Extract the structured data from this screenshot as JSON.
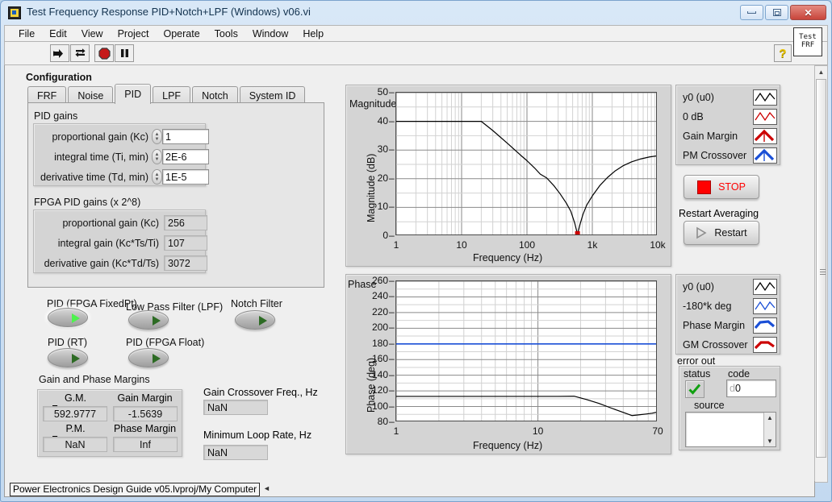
{
  "window": {
    "title": "Test Frequency Response PID+Notch+LPF (Windows) v06.vi",
    "minimize_label": "Minimize",
    "restore_label": "Restore",
    "close_label": "Close"
  },
  "menu": {
    "items": [
      "File",
      "Edit",
      "View",
      "Project",
      "Operate",
      "Tools",
      "Window",
      "Help"
    ]
  },
  "toolbar": {
    "run_label": "Run",
    "run_continuous_label": "Run Continuously",
    "abort_label": "Abort Execution",
    "pause_label": "Pause",
    "help_label": "?",
    "vi_icon_line1": "Test",
    "vi_icon_line2": "FRF"
  },
  "configuration": {
    "label": "Configuration",
    "tabs": [
      {
        "label": "FRF",
        "active": false
      },
      {
        "label": "Noise",
        "active": false
      },
      {
        "label": "PID",
        "active": true
      },
      {
        "label": "LPF",
        "active": false
      },
      {
        "label": "Notch",
        "active": false
      },
      {
        "label": "System ID",
        "active": false
      }
    ]
  },
  "pid_gains": {
    "title": "PID gains",
    "rows": [
      {
        "label": "proportional gain (Kc)",
        "value": "1"
      },
      {
        "label": "integral time (Ti, min)",
        "value": "2E-6"
      },
      {
        "label": "derivative time (Td, min)",
        "value": "1E-5"
      }
    ]
  },
  "fpga_pid_gains": {
    "title": "FPGA PID gains (x 2^8)",
    "rows": [
      {
        "label": "proportional gain (Kc)",
        "value": "256"
      },
      {
        "label": "integral gain (Kc*Ts/Ti)",
        "value": "107"
      },
      {
        "label": "derivative gain (Kc*Td/Ts)",
        "value": "3072"
      }
    ]
  },
  "toggles": [
    {
      "label": "PID (FPGA FixedPt)",
      "state": "on"
    },
    {
      "label": "Low Pass Filter (LPF)",
      "state": "off"
    },
    {
      "label": "Notch Filter",
      "state": "off"
    },
    {
      "label": "PID (RT)",
      "state": "off"
    },
    {
      "label": "PID (FPGA Float)",
      "state": "off"
    }
  ],
  "margins": {
    "title": "Gain and Phase Margins",
    "headers": [
      "G.M. Frequency",
      "Gain Margin",
      "P.M. Frequency",
      "Phase Margin"
    ],
    "values": [
      "592.9777",
      "-1.5639",
      "NaN",
      "Inf"
    ]
  },
  "crossover": {
    "gain_label": "Gain Crossover Freq., Hz",
    "gain_value": "NaN",
    "loop_label": "Minimum Loop Rate, Hz",
    "loop_value": "NaN"
  },
  "stop_button": {
    "label": "STOP"
  },
  "restart": {
    "caption": "Restart Averaging",
    "label": "Restart"
  },
  "error_out": {
    "title": "error out",
    "status_label": "status",
    "code_label": "code",
    "code_value": "0",
    "code_prefix": "d",
    "source_label": "source",
    "source_value": ""
  },
  "magnitude_legend": {
    "rows": [
      {
        "label": "y0 (u0)",
        "color": "#000000",
        "style": "line"
      },
      {
        "label": "0 dB",
        "color": "#cc0000",
        "style": "line"
      },
      {
        "label": "Gain Margin",
        "color": "#cc0000",
        "style": "arrow"
      },
      {
        "label": "PM Crossover",
        "color": "#1a4fd6",
        "style": "arrow"
      }
    ]
  },
  "phase_legend": {
    "rows": [
      {
        "label": "y0 (u0)",
        "color": "#000000",
        "style": "line"
      },
      {
        "label": "-180*k deg",
        "color": "#1a4fd6",
        "style": "line"
      },
      {
        "label": "Phase Margin",
        "color": "#1a4fd6",
        "style": "bold"
      },
      {
        "label": "GM Crossover",
        "color": "#cc0000",
        "style": "bold"
      }
    ]
  },
  "statusbar": {
    "path": "Power Electronics Design Guide v05.lvproj/My Computer"
  },
  "chart_data": [
    {
      "type": "line",
      "name": "magnitude",
      "title": "Magnitude",
      "xlabel": "Frequency (Hz)",
      "ylabel": "Magnitude (dB)",
      "xscale": "log",
      "xlim": [
        1,
        10000
      ],
      "ylim": [
        0,
        50
      ],
      "yticks": [
        0,
        10,
        20,
        30,
        40,
        50
      ],
      "xticks": [
        1,
        10,
        100,
        1000,
        10000
      ],
      "xticklabels": [
        "1",
        "10",
        "100",
        "1k",
        "10k"
      ],
      "grid": true,
      "series": [
        {
          "name": "y0 (u0)",
          "color": "#000000",
          "x": [
            1,
            2,
            5,
            10,
            15,
            20,
            30,
            50,
            80,
            100,
            130,
            160,
            200,
            260,
            320,
            400,
            470,
            540,
            593,
            650,
            720,
            820,
            1000,
            1300,
            1700,
            2200,
            3000,
            4000,
            5500,
            7500,
            10000
          ],
          "y": [
            40,
            40,
            40,
            40,
            40,
            40,
            36.8,
            32.4,
            28.2,
            26.3,
            23.8,
            21.6,
            20.3,
            17.5,
            14.8,
            11.5,
            8.6,
            4.4,
            0.6,
            4.2,
            7.6,
            10.8,
            14.0,
            17.6,
            20.4,
            22.6,
            24.6,
            25.9,
            26.9,
            27.6,
            28.0
          ]
        },
        {
          "name": "0 dB",
          "color": "#cc0000",
          "x": [
            1,
            10000
          ],
          "y": [
            0,
            0
          ]
        }
      ],
      "markers": [
        {
          "name": "gain-margin-marker",
          "x": 593,
          "y": 0.6,
          "color": "#cc0000"
        }
      ]
    },
    {
      "type": "line",
      "name": "phase",
      "title": "Phase",
      "xlabel": "Frequency (Hz)",
      "ylabel": "Phase (deg)",
      "xscale": "log",
      "xlim": [
        1,
        70
      ],
      "ylim": [
        80,
        260
      ],
      "yticks": [
        80,
        100,
        120,
        140,
        160,
        180,
        200,
        220,
        240,
        260
      ],
      "xticks": [
        1,
        10,
        70
      ],
      "xticklabels": [
        "1",
        "10",
        "70"
      ],
      "grid": true,
      "series": [
        {
          "name": "y0 (u0)",
          "color": "#000000",
          "x": [
            1,
            3,
            6,
            10,
            14,
            18,
            22,
            27,
            33,
            40,
            46,
            52,
            58,
            64,
            70
          ],
          "y": [
            113,
            113,
            113,
            113,
            113,
            113.2,
            109,
            104,
            98,
            92.5,
            88.5,
            89.5,
            90.5,
            91.5,
            93
          ]
        },
        {
          "name": "-180*k deg",
          "color": "#1a4fd6",
          "x": [
            1,
            70
          ],
          "y": [
            180,
            180
          ]
        }
      ]
    }
  ]
}
